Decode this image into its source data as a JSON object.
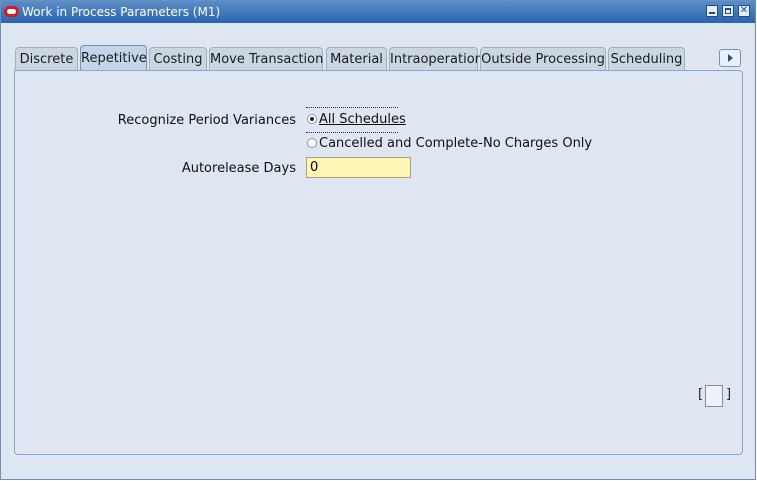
{
  "window": {
    "title": "Work in Process Parameters (M1)"
  },
  "tabs": [
    {
      "label": "Discrete"
    },
    {
      "label": "Repetitive"
    },
    {
      "label": "Costing"
    },
    {
      "label": "Move Transaction"
    },
    {
      "label": "Material"
    },
    {
      "label": "Intraoperation"
    },
    {
      "label": "Outside Processing"
    },
    {
      "label": "Scheduling"
    }
  ],
  "active_tab": "Repetitive",
  "form": {
    "period_variances_label": "Recognize Period Variances",
    "options": [
      {
        "label": "All Schedules",
        "mnemonic": "A",
        "selected": true
      },
      {
        "label": "Cancelled and Complete-No Charges Only",
        "mnemonic": "C",
        "selected": false
      }
    ],
    "autorelease_label": "Autorelease Days",
    "autorelease_value": "0"
  },
  "colors": {
    "title_bar": "#2a64b0",
    "background": "#dee7f1",
    "field_required": "#fff5b5",
    "logo": "#d51b1b"
  }
}
